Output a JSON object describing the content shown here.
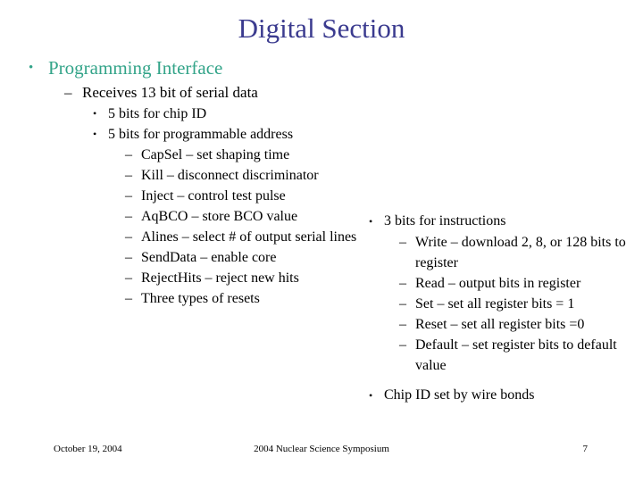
{
  "slide": {
    "title": "Digital Section",
    "title_color": "#3b3b8f",
    "accent_color": "#33a489",
    "background_color": "#ffffff"
  },
  "bullets": {
    "l1_marker": "•",
    "l2_marker": "–",
    "l3_marker": "•",
    "l4_marker": "–"
  },
  "left_column": {
    "level1": "Programming Interface",
    "level2": "Receives 13 bit of serial data",
    "level3": [
      "5 bits for chip ID",
      "5 bits for programmable address"
    ],
    "level4": [
      "CapSel – set shaping time",
      "Kill – disconnect discriminator",
      "Inject – control test pulse",
      "AqBCO – store BCO value",
      "Alines – select # of output serial lines",
      "SendData – enable core",
      "RejectHits – reject new hits",
      "Three types of resets"
    ]
  },
  "right_column": {
    "heading": "3 bits for instructions",
    "items": [
      "Write – download 2, 8, or 128 bits to register",
      "Read – output bits in register",
      "Set – set all register bits = 1",
      "Reset – set all register bits =0",
      "Default – set register bits to default value"
    ],
    "closing": "Chip ID set by wire bonds"
  },
  "footer": {
    "date": "October 19, 2004",
    "event": "2004 Nuclear Science Symposium",
    "page_number": "7"
  }
}
